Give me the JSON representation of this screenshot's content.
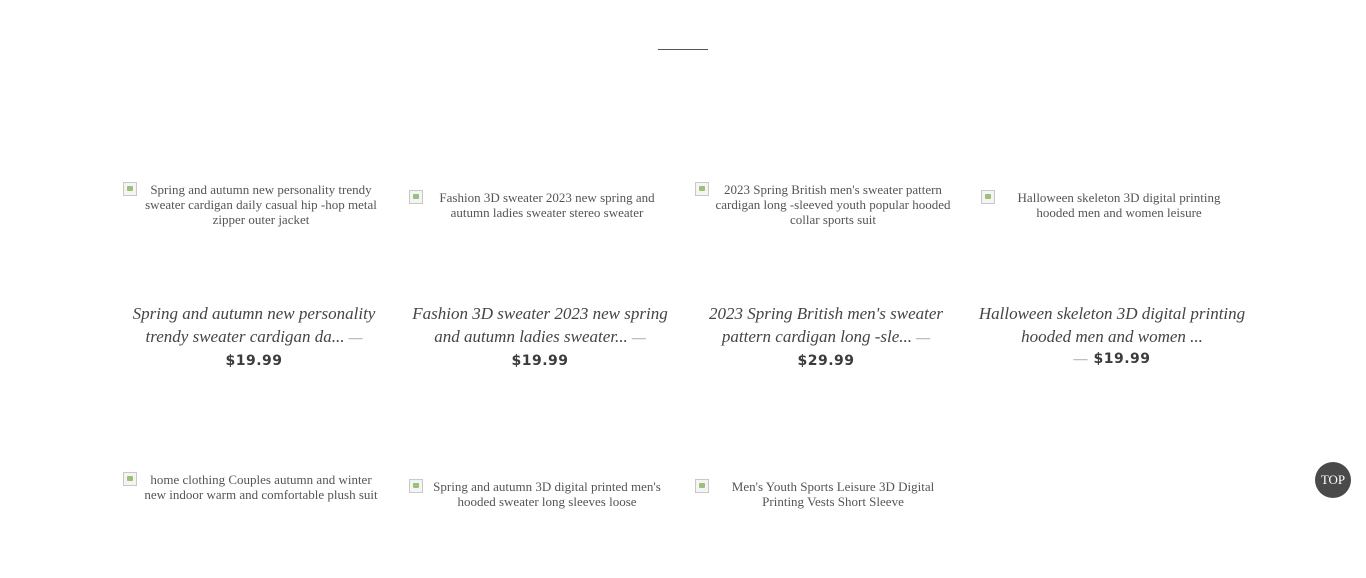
{
  "products": [
    {
      "image_alt": "Spring and autumn new personality trendy sweater cardigan daily casual hip -hop metal zipper outer jacket",
      "title": "Spring and autumn new personality trendy sweater cardigan da...",
      "separator": "—",
      "price": "$19.99"
    },
    {
      "image_alt": "Fashion 3D sweater 2023 new spring and autumn ladies sweater stereo sweater",
      "title": "Fashion 3D sweater 2023 new spring and autumn ladies sweater...",
      "separator": "—",
      "price": "$19.99"
    },
    {
      "image_alt": "2023 Spring British men's sweater pattern cardigan long -sleeved youth popular hooded collar sports suit",
      "title": "2023 Spring British men's sweater pattern cardigan long -sle...",
      "separator": "—",
      "price": "$29.99"
    },
    {
      "image_alt": "Halloween skeleton 3D digital printing hooded men and women leisure",
      "title": "Halloween skeleton 3D digital printing hooded men and women ...",
      "separator": "—",
      "price": "$19.99"
    },
    {
      "image_alt": "home clothing Couples autumn and winter new indoor warm and comfortable plush suit"
    },
    {
      "image_alt": "Spring and autumn 3D digital printed men's hooded sweater long sleeves loose"
    },
    {
      "image_alt": "Men's Youth Sports Leisure 3D Digital Printing Vests Short Sleeve"
    }
  ],
  "back_to_top": {
    "label": "TOP"
  }
}
